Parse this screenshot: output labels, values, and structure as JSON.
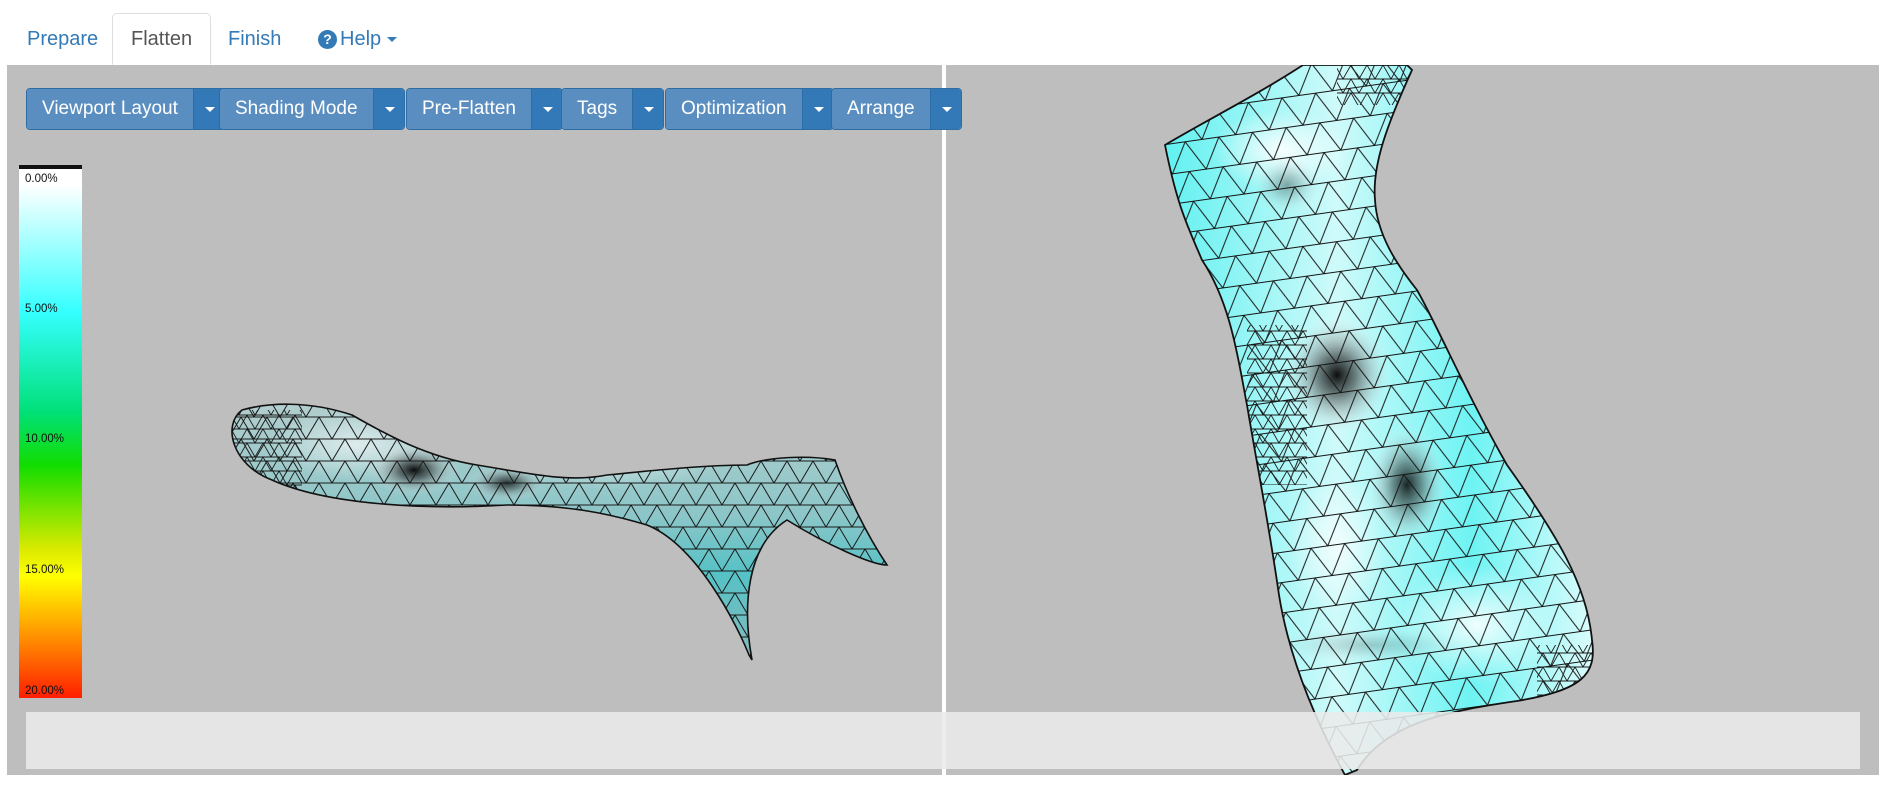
{
  "tabs": [
    {
      "label": "Prepare"
    },
    {
      "label": "Flatten"
    },
    {
      "label": "Finish"
    }
  ],
  "help": {
    "label": "Help"
  },
  "toolbar": {
    "buttons": [
      {
        "label": "Viewport Layout"
      },
      {
        "label": "Shading Mode"
      },
      {
        "label": "Pre-Flatten"
      },
      {
        "label": "Tags"
      },
      {
        "label": "Optimization"
      },
      {
        "label": "Arrange"
      }
    ]
  },
  "legend": {
    "labels": [
      "0.00%",
      "5.00%",
      "10.00%",
      "15.00%",
      "20.00%"
    ]
  },
  "status_bar": {
    "text": ""
  },
  "colors": {
    "viewport_bg": "#bebebe",
    "button_main": "#5b8ec0",
    "button_caret": "#3479b7",
    "link": "#337ab7",
    "mesh_3d_fill": "#7fc4c8",
    "mesh_flat_fill": "#7ff2f2"
  },
  "icons": {
    "help": "question-circle-icon",
    "dropdown": "caret-down-icon"
  }
}
